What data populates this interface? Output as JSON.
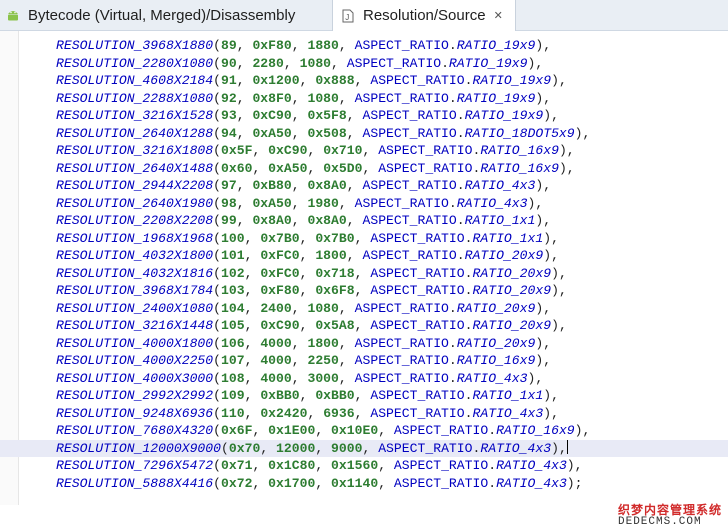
{
  "tabs": [
    {
      "label": "Bytecode (Virtual, Merged)/Disassembly",
      "icon": "android-icon"
    },
    {
      "label": "Resolution/Source",
      "icon": "source-file-icon",
      "close": "✕"
    }
  ],
  "code_lines": [
    {
      "name": "RESOLUTION_3968X1880",
      "a": "89",
      "b": "0xF80",
      "c": "1880",
      "ratio": "RATIO_19x9",
      "end": ","
    },
    {
      "name": "RESOLUTION_2280X1080",
      "a": "90",
      "b": "2280",
      "c": "1080",
      "ratio": "RATIO_19x9",
      "end": ","
    },
    {
      "name": "RESOLUTION_4608X2184",
      "a": "91",
      "b": "0x1200",
      "c": "0x888",
      "ratio": "RATIO_19x9",
      "end": ","
    },
    {
      "name": "RESOLUTION_2288X1080",
      "a": "92",
      "b": "0x8F0",
      "c": "1080",
      "ratio": "RATIO_19x9",
      "end": ","
    },
    {
      "name": "RESOLUTION_3216X1528",
      "a": "93",
      "b": "0xC90",
      "c": "0x5F8",
      "ratio": "RATIO_19x9",
      "end": ","
    },
    {
      "name": "RESOLUTION_2640X1288",
      "a": "94",
      "b": "0xA50",
      "c": "0x508",
      "ratio": "RATIO_18DOT5x9",
      "end": ","
    },
    {
      "name": "RESOLUTION_3216X1808",
      "a": "0x5F",
      "b": "0xC90",
      "c": "0x710",
      "ratio": "RATIO_16x9",
      "end": ","
    },
    {
      "name": "RESOLUTION_2640X1488",
      "a": "0x60",
      "b": "0xA50",
      "c": "0x5D0",
      "ratio": "RATIO_16x9",
      "end": ","
    },
    {
      "name": "RESOLUTION_2944X2208",
      "a": "97",
      "b": "0xB80",
      "c": "0x8A0",
      "ratio": "RATIO_4x3",
      "end": ","
    },
    {
      "name": "RESOLUTION_2640X1980",
      "a": "98",
      "b": "0xA50",
      "c": "1980",
      "ratio": "RATIO_4x3",
      "end": ","
    },
    {
      "name": "RESOLUTION_2208X2208",
      "a": "99",
      "b": "0x8A0",
      "c": "0x8A0",
      "ratio": "RATIO_1x1",
      "end": ","
    },
    {
      "name": "RESOLUTION_1968X1968",
      "a": "100",
      "b": "0x7B0",
      "c": "0x7B0",
      "ratio": "RATIO_1x1",
      "end": ","
    },
    {
      "name": "RESOLUTION_4032X1800",
      "a": "101",
      "b": "0xFC0",
      "c": "1800",
      "ratio": "RATIO_20x9",
      "end": ","
    },
    {
      "name": "RESOLUTION_4032X1816",
      "a": "102",
      "b": "0xFC0",
      "c": "0x718",
      "ratio": "RATIO_20x9",
      "end": ","
    },
    {
      "name": "RESOLUTION_3968X1784",
      "a": "103",
      "b": "0xF80",
      "c": "0x6F8",
      "ratio": "RATIO_20x9",
      "end": ","
    },
    {
      "name": "RESOLUTION_2400X1080",
      "a": "104",
      "b": "2400",
      "c": "1080",
      "ratio": "RATIO_20x9",
      "end": ","
    },
    {
      "name": "RESOLUTION_3216X1448",
      "a": "105",
      "b": "0xC90",
      "c": "0x5A8",
      "ratio": "RATIO_20x9",
      "end": ","
    },
    {
      "name": "RESOLUTION_4000X1800",
      "a": "106",
      "b": "4000",
      "c": "1800",
      "ratio": "RATIO_20x9",
      "end": ","
    },
    {
      "name": "RESOLUTION_4000X2250",
      "a": "107",
      "b": "4000",
      "c": "2250",
      "ratio": "RATIO_16x9",
      "end": ","
    },
    {
      "name": "RESOLUTION_4000X3000",
      "a": "108",
      "b": "4000",
      "c": "3000",
      "ratio": "RATIO_4x3",
      "end": ","
    },
    {
      "name": "RESOLUTION_2992X2992",
      "a": "109",
      "b": "0xBB0",
      "c": "0xBB0",
      "ratio": "RATIO_1x1",
      "end": ","
    },
    {
      "name": "RESOLUTION_9248X6936",
      "a": "110",
      "b": "0x2420",
      "c": "6936",
      "ratio": "RATIO_4x3",
      "end": ","
    },
    {
      "name": "RESOLUTION_7680X4320",
      "a": "0x6F",
      "b": "0x1E00",
      "c": "0x10E0",
      "ratio": "RATIO_16x9",
      "end": ","
    },
    {
      "name": "RESOLUTION_12000X9000",
      "a": "0x70",
      "b": "12000",
      "c": "9000",
      "ratio": "RATIO_4x3",
      "end": ","
    },
    {
      "name": "RESOLUTION_7296X5472",
      "a": "0x71",
      "b": "0x1C80",
      "c": "0x1560",
      "ratio": "RATIO_4x3",
      "end": ","
    },
    {
      "name": "RESOLUTION_5888X4416",
      "a": "0x72",
      "b": "0x1700",
      "c": "0x1140",
      "ratio": "RATIO_4x3",
      "end": ";"
    }
  ],
  "aspect_class": "ASPECT_RATIO",
  "selected_line_index": 23,
  "watermark": {
    "line1": "织梦内容管理系统",
    "line2": "DEDECMS.COM"
  },
  "colors": {
    "field": "#0000c0",
    "number": "#2e7d32",
    "selection": "#e8eaf6"
  }
}
